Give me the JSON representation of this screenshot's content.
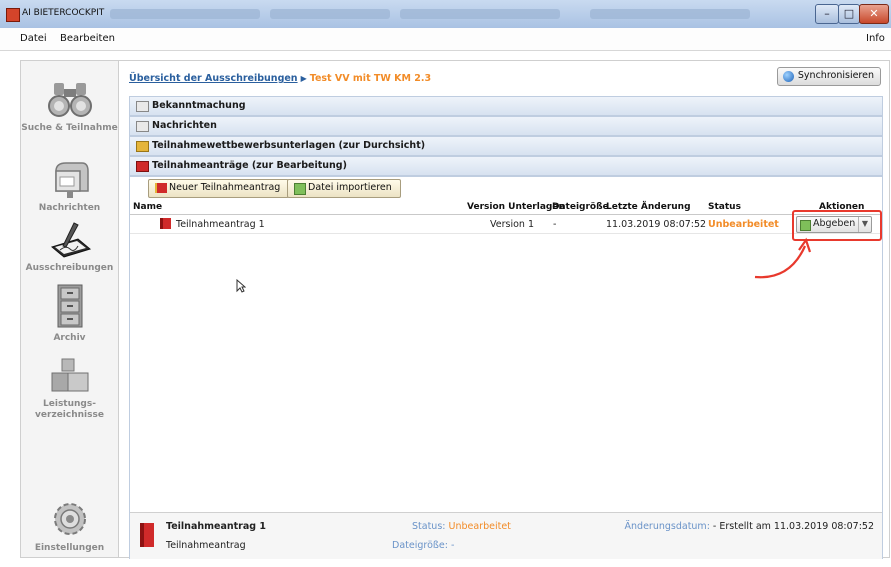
{
  "window": {
    "title": "AI BIETERCOCKPIT",
    "buttons": [
      "–",
      "□",
      "✕"
    ]
  },
  "menu": {
    "items": [
      "Datei",
      "Bearbeiten"
    ],
    "info": "Info"
  },
  "sidebar": {
    "items": [
      {
        "label": "Suche & Teilnahme",
        "icon": "binoculars-icon"
      },
      {
        "label": "Nachrichten",
        "icon": "mailbox-icon"
      },
      {
        "label": "Ausschreibungen",
        "icon": "signature-pad-icon",
        "active": true
      },
      {
        "label": "Archiv",
        "icon": "filing-cabinet-icon"
      },
      {
        "label": "Leistungs-verzeichnisse",
        "icon": "cubes-icon"
      },
      {
        "label": "Einstellungen",
        "icon": "gear-icon"
      }
    ]
  },
  "breadcrumb": {
    "link": "Übersicht der Ausschreibungen",
    "current": "Test VV mit TW KM 2.3"
  },
  "sync_button": "Synchronisieren",
  "sections": [
    {
      "label": "Bekanntmachung",
      "icon": "page-icon"
    },
    {
      "label": "Nachrichten",
      "icon": "page-icon"
    },
    {
      "label": "Teilnahmewettbewerbsunterlagen (zur Durchsicht)",
      "icon": "book-icon"
    },
    {
      "label": "Teilnahmeanträge (zur Bearbeitung)",
      "icon": "red-book-icon"
    }
  ],
  "toolbar": {
    "new_label": "Neuer Teilnahmeantrag",
    "import_label": "Datei importieren"
  },
  "table": {
    "columns": [
      "Name",
      "Version Unterlagen",
      "Dateigröße",
      "Letzte Änderung",
      "Status",
      "Aktionen"
    ],
    "rows": [
      {
        "name": "Teilnahmeantrag 1",
        "version": "Version 1",
        "size": "-",
        "changed": "11.03.2019 08:07:52",
        "status": "Unbearbeitet",
        "action": "Abgeben"
      }
    ]
  },
  "footer": {
    "title": "Teilnahmeantrag 1",
    "type": "Teilnahmeantrag",
    "status_label": "Status:",
    "status_value": "Unbearbeitet",
    "size_label": "Dateigröße:",
    "size_value": "-",
    "date_label": "Änderungsdatum:",
    "date_value": "- Erstellt am 11.03.2019 08:07:52"
  },
  "colors": {
    "accent": "#2a5f9e",
    "status": "#f28c28",
    "annotation": "#e8392d"
  }
}
